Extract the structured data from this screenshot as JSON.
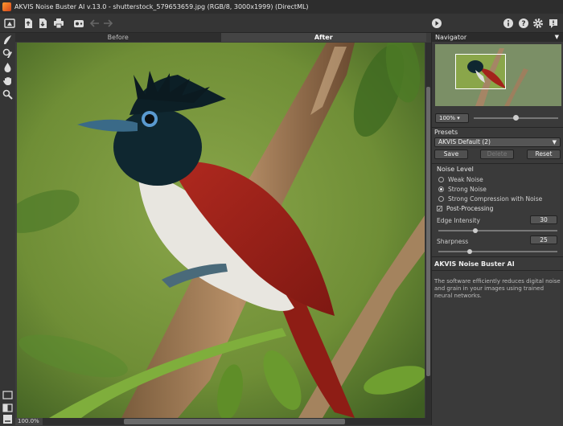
{
  "window": {
    "title": "AKVIS Noise Buster AI v.13.0 - shutterstock_579653659.jpg (RGB/8, 3000x1999) (DirectML)"
  },
  "tabs": [
    {
      "label": "Before"
    },
    {
      "label": "After"
    }
  ],
  "status": {
    "zoom": "100.0%"
  },
  "navigator": {
    "header": "Navigator",
    "zoom_value": "100%",
    "zoom_slider_fraction": 0.5
  },
  "presets": {
    "label": "Presets",
    "selected": "AKVIS Default (2)",
    "save_label": "Save",
    "delete_label": "Delete",
    "reset_label": "Reset"
  },
  "noise_level": {
    "label": "Noise Level",
    "options": [
      "Weak Noise",
      "Strong Noise",
      "Strong Compression with Noise"
    ],
    "selected_index": 1
  },
  "post_processing": {
    "label": "Post-Processing",
    "checked": true,
    "edge_label": "Edge Intensity",
    "edge_value": "30",
    "edge_fraction": 0.3,
    "sharp_label": "Sharpness",
    "sharp_value": "25",
    "sharp_fraction": 0.25
  },
  "about": {
    "title": "AKVIS Noise Buster AI",
    "text": "The software efficiently reduces digital noise and grain in your images using trained neural networks."
  },
  "colors": {
    "bird_red": "#a3231b",
    "bird_head": "#0f2730",
    "background_green": "#6b8f3a"
  }
}
